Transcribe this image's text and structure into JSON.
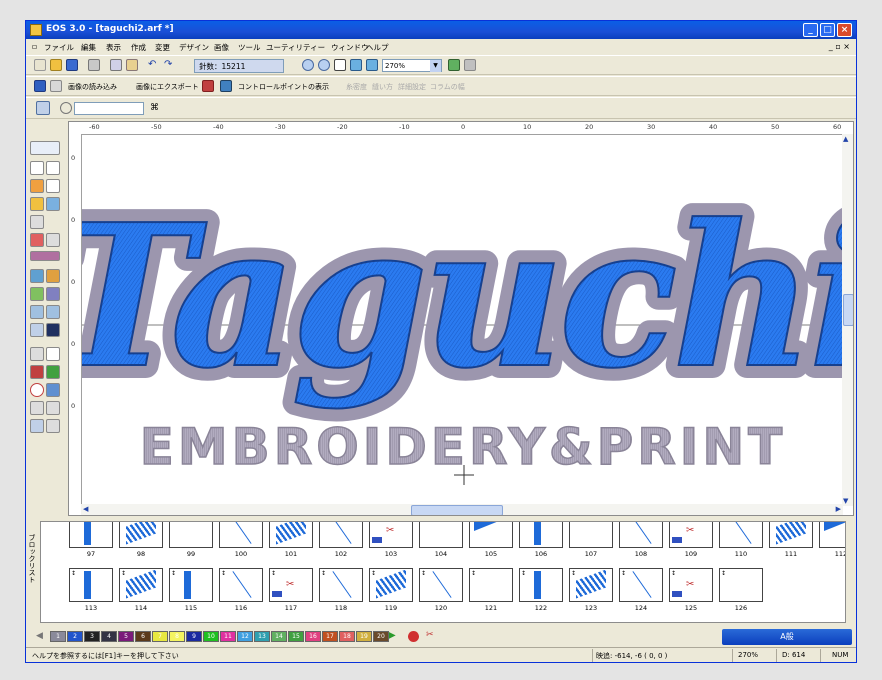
{
  "window": {
    "title": "EOS 3.0 - [taguchi2.arf *]",
    "buttons": [
      "_",
      "□",
      "×"
    ]
  },
  "menu": {
    "items": [
      "ファイル",
      "編集",
      "表示",
      "作成",
      "変更",
      "デザイン",
      "画像",
      "ツール",
      "ユーティリティー",
      "ウィンドウ",
      "ヘルプ"
    ],
    "mdi_controls": "_ ▫ ×"
  },
  "toolbar": {
    "stitch_count": "針数：15211",
    "zoom": "270%"
  },
  "toolbar2": {
    "load_image": "画像の読み込み",
    "export_image": "画像にエクスポート",
    "show_control_points": "コントロールポイントの表示",
    "disabled_items": [
      "糸密度",
      "縫い方",
      "詳細設定",
      "コラムの幅"
    ]
  },
  "canvas": {
    "hruler_labels": [
      "-60",
      "-50",
      "-40",
      "-30",
      "-20",
      "-10",
      "0",
      "10",
      "20",
      "30",
      "40",
      "50",
      "60"
    ],
    "vruler_labels": [
      "0",
      "0",
      "0",
      "0",
      "0"
    ],
    "design_title": "Taguchi",
    "design_subtitle": "EMBROIDERY&PRINT",
    "colors": {
      "fill": "#2b7bf0",
      "outline": "#a8a2b8",
      "sub": "#a9a3b6"
    }
  },
  "block_list": {
    "side_label": "ブロックリスト",
    "row1": [
      "97",
      "98",
      "99",
      "100",
      "101",
      "102",
      "103",
      "104",
      "105",
      "106",
      "107",
      "108",
      "109",
      "110",
      "111",
      "112"
    ],
    "row2": [
      "113",
      "114",
      "115",
      "116",
      "117",
      "118",
      "119",
      "120",
      "121",
      "122",
      "123",
      "124",
      "125",
      "126"
    ]
  },
  "palette": {
    "swatches": [
      {
        "n": "1",
        "c": "#8a8a9a"
      },
      {
        "n": "2",
        "c": "#2255cc"
      },
      {
        "n": "3",
        "c": "#222222"
      },
      {
        "n": "4",
        "c": "#333344"
      },
      {
        "n": "5",
        "c": "#7a1a7a"
      },
      {
        "n": "6",
        "c": "#5b3a1a"
      },
      {
        "n": "7",
        "c": "#e8e840"
      },
      {
        "n": "8",
        "c": "#f4f460"
      },
      {
        "n": "9",
        "c": "#1a2aa0"
      },
      {
        "n": "10",
        "c": "#20c020"
      },
      {
        "n": "11",
        "c": "#e030a0"
      },
      {
        "n": "12",
        "c": "#40a0e0"
      },
      {
        "n": "13",
        "c": "#30a0b0"
      },
      {
        "n": "14",
        "c": "#60b060"
      },
      {
        "n": "15",
        "c": "#40a040"
      },
      {
        "n": "16",
        "c": "#e04080"
      },
      {
        "n": "17",
        "c": "#c05020"
      },
      {
        "n": "18",
        "c": "#e06060"
      },
      {
        "n": "19",
        "c": "#d0b040"
      },
      {
        "n": "20",
        "c": "#6a4a2a"
      }
    ],
    "ime_text": "A般"
  },
  "status": {
    "help": "ヘルプを参照するには[F1]キーを押して下さい",
    "coords": "映追: -614, -6  ( 0, 0 )",
    "zoom": "270%",
    "d_value": "D: 614",
    "num": "NUM"
  }
}
